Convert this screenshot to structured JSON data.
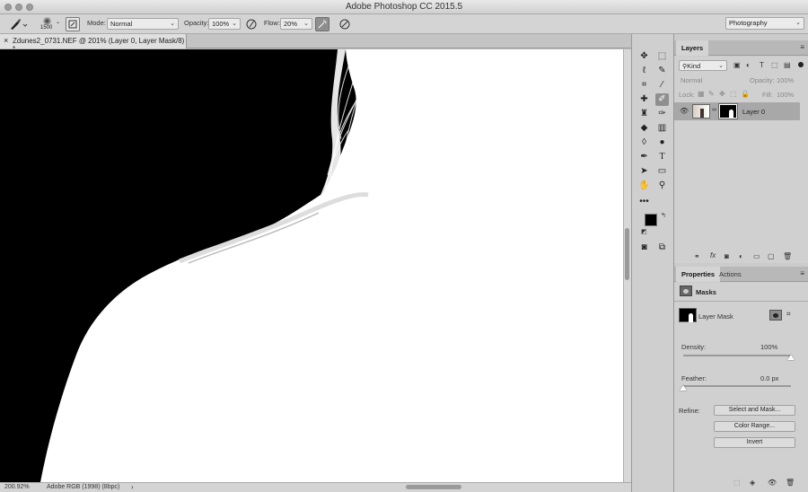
{
  "window": {
    "title": "Adobe Photoshop CC 2015.5"
  },
  "workspace": {
    "selected": "Photography"
  },
  "options_bar": {
    "brush_size": "1500",
    "mode_label": "Mode:",
    "mode_value": "Normal",
    "opacity_label": "Opacity:",
    "opacity_value": "100%",
    "flow_label": "Flow:",
    "flow_value": "20%"
  },
  "document": {
    "close_glyph": "×",
    "tab_title": "Zdunes2_0731.NEF @ 201% (Layer 0, Layer Mask/8) *",
    "zoom": "200.92%",
    "color_profile": "Adobe RGB (1998) (8bpc)",
    "status_arrow": "›"
  },
  "layers_panel": {
    "tab": "Layers",
    "filter_kind": "Kind",
    "blend_mode": "Normal",
    "opacity_label": "Opacity:",
    "opacity_value": "100%",
    "lock_label": "Lock:",
    "fill_label": "Fill:",
    "fill_value": "100%",
    "layers": [
      {
        "name": "Layer 0",
        "visible": true,
        "selected": true
      }
    ]
  },
  "properties_panel": {
    "tabs": [
      "Properties",
      "Actions"
    ],
    "section": "Masks",
    "mask_type": "Layer Mask",
    "density_label": "Density:",
    "density_value": "100%",
    "density_fraction": 1.0,
    "feather_label": "Feather:",
    "feather_value": "0.0 px",
    "feather_fraction": 0.0,
    "refine_label": "Refine:",
    "buttons": [
      "Select and Mask...",
      "Color Range...",
      "Invert"
    ]
  },
  "tool_icons": [
    "move-icon",
    "marquee-icon",
    "lasso-icon",
    "quick-select-icon",
    "crop-icon",
    "eyedropper-icon",
    "healing-icon",
    "brush-icon",
    "stamp-icon",
    "history-brush-icon",
    "eraser-icon",
    "gradient-icon",
    "blur-icon",
    "dodge-icon",
    "pen-icon",
    "type-icon",
    "path-select-icon",
    "shape-icon",
    "hand-icon",
    "zoom-icon",
    "more-icon"
  ],
  "colors": {
    "foreground": "#000000",
    "background": "#ffffff",
    "canvas_mask_black": "#000000"
  }
}
